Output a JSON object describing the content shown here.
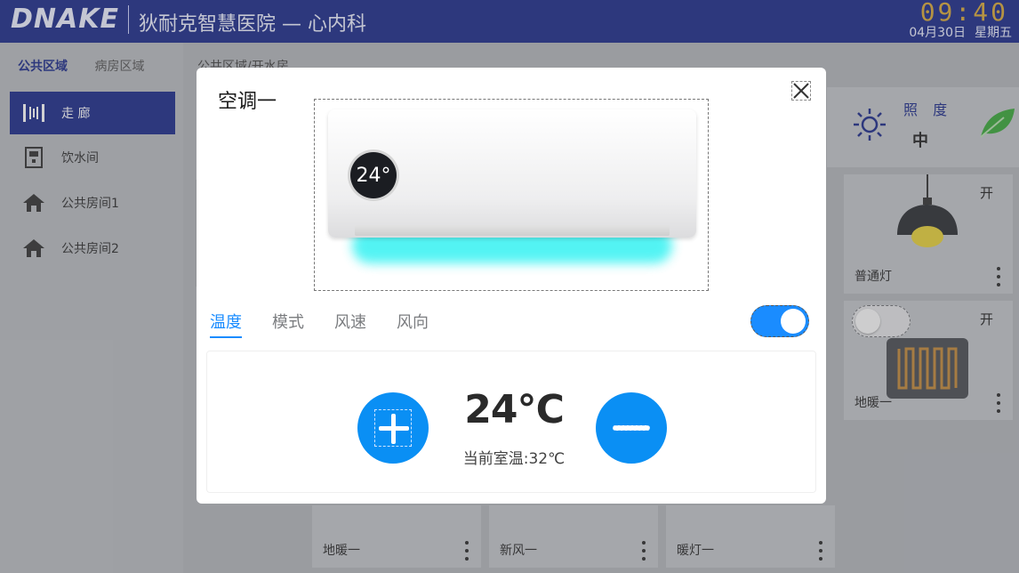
{
  "header": {
    "logo": "DNAKE",
    "hospital": "狄耐克智慧医院 — 心内科",
    "time": "09:40",
    "date": "04月30日",
    "weekday": "星期五"
  },
  "sidebar": {
    "zone_tabs": [
      {
        "label": "公共区域",
        "active": true
      },
      {
        "label": "病房区域",
        "active": false
      }
    ],
    "items": [
      {
        "label": "走 廊",
        "icon": "corridor-icon",
        "active": true
      },
      {
        "label": "饮水间",
        "icon": "water-dispenser-icon",
        "active": false
      },
      {
        "label": "公共房间1",
        "icon": "home-icon",
        "active": false
      },
      {
        "label": "公共房间2",
        "icon": "home-icon",
        "active": false
      }
    ]
  },
  "content": {
    "breadcrumb": "公共区域/开水房",
    "illuminance": {
      "label": "照 度",
      "value": "中",
      "icon": "sun-icon"
    },
    "eco_icon": "leaf-icon",
    "devices": [
      {
        "name": "普通灯",
        "state": "开",
        "icon": "pendant-lamp-icon"
      },
      {
        "name": "地暖一",
        "state": "开",
        "icon": "floor-heating-icon"
      },
      {
        "name": "地暖一",
        "state": "",
        "icon": ""
      },
      {
        "name": "新风一",
        "state": "",
        "icon": ""
      },
      {
        "name": "暖灯一",
        "state": "",
        "icon": ""
      }
    ]
  },
  "modal": {
    "title": "空调一",
    "close_icon": "close-icon",
    "badge_temp": "24°",
    "tabs": [
      {
        "label": "温度",
        "active": true
      },
      {
        "label": "模式",
        "active": false
      },
      {
        "label": "风速",
        "active": false
      },
      {
        "label": "风向",
        "active": false
      }
    ],
    "power_on": true,
    "set_temperature": "24℃",
    "current_room_temp": "当前室温:32℃",
    "accent_color": "#0a8ff4"
  }
}
